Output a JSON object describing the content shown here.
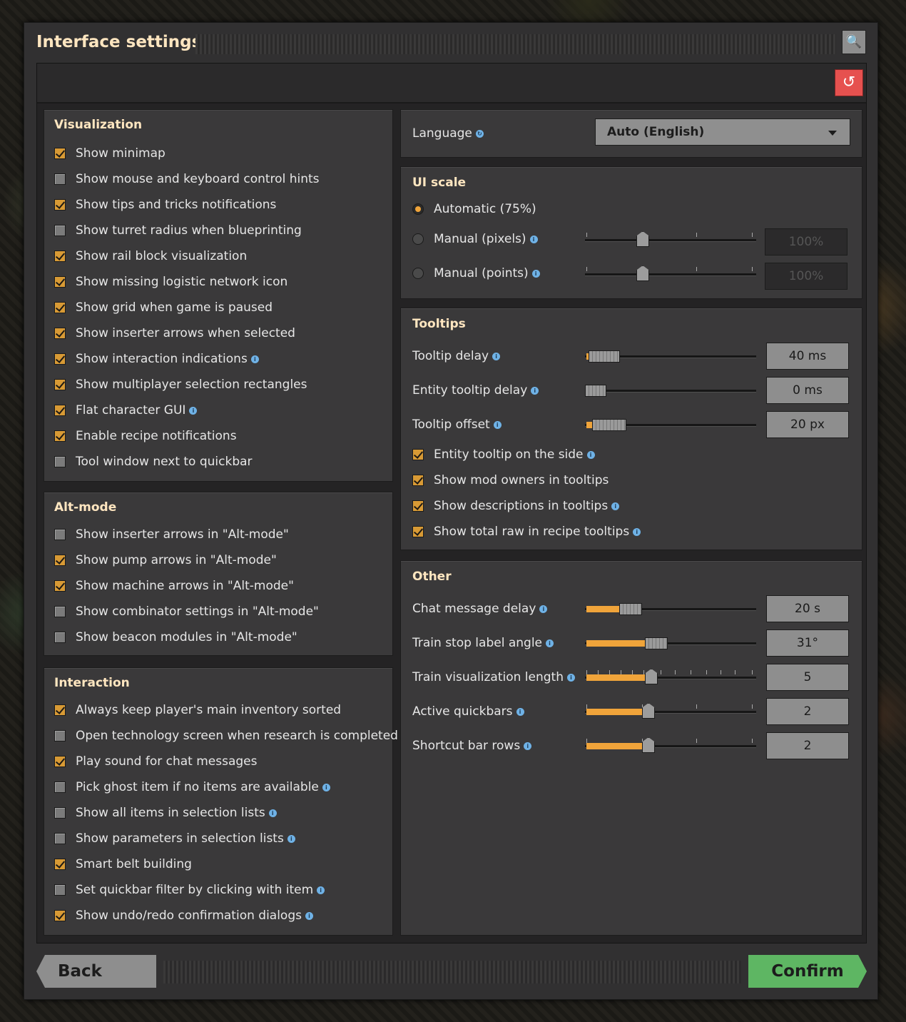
{
  "window": {
    "title": "Interface settings"
  },
  "buttons": {
    "back": "Back",
    "confirm": "Confirm"
  },
  "visualization": {
    "title": "Visualization",
    "items": [
      {
        "label": "Show minimap",
        "checked": true,
        "info": false
      },
      {
        "label": "Show mouse and keyboard control hints",
        "checked": false,
        "info": false
      },
      {
        "label": "Show tips and tricks notifications",
        "checked": true,
        "info": false
      },
      {
        "label": "Show turret radius when blueprinting",
        "checked": false,
        "info": false
      },
      {
        "label": "Show rail block visualization",
        "checked": true,
        "info": false
      },
      {
        "label": "Show missing logistic network icon",
        "checked": true,
        "info": false
      },
      {
        "label": "Show grid when game is paused",
        "checked": true,
        "info": false
      },
      {
        "label": "Show inserter arrows when selected",
        "checked": true,
        "info": false
      },
      {
        "label": "Show interaction indications",
        "checked": true,
        "info": true
      },
      {
        "label": "Show multiplayer selection rectangles",
        "checked": true,
        "info": false
      },
      {
        "label": "Flat character GUI",
        "checked": true,
        "info": true
      },
      {
        "label": "Enable recipe notifications",
        "checked": true,
        "info": false
      },
      {
        "label": "Tool window next to quickbar",
        "checked": false,
        "info": false
      }
    ]
  },
  "altmode": {
    "title": "Alt-mode",
    "items": [
      {
        "label": "Show inserter arrows in \"Alt-mode\"",
        "checked": false,
        "info": false
      },
      {
        "label": "Show pump arrows in \"Alt-mode\"",
        "checked": true,
        "info": false
      },
      {
        "label": "Show machine arrows in \"Alt-mode\"",
        "checked": true,
        "info": false
      },
      {
        "label": "Show combinator settings in \"Alt-mode\"",
        "checked": false,
        "info": false
      },
      {
        "label": "Show beacon modules in \"Alt-mode\"",
        "checked": false,
        "info": false
      }
    ]
  },
  "interaction": {
    "title": "Interaction",
    "items": [
      {
        "label": "Always keep player's main inventory sorted",
        "checked": true,
        "info": false
      },
      {
        "label": "Open technology screen when research is completed",
        "checked": false,
        "info": false
      },
      {
        "label": "Play sound for chat messages",
        "checked": true,
        "info": false
      },
      {
        "label": "Pick ghost item if no items are available",
        "checked": false,
        "info": true
      },
      {
        "label": "Show all items in selection lists",
        "checked": false,
        "info": true
      },
      {
        "label": "Show parameters in selection lists",
        "checked": false,
        "info": true
      },
      {
        "label": "Smart belt building",
        "checked": true,
        "info": false
      },
      {
        "label": "Set quickbar filter by clicking with item",
        "checked": false,
        "info": true
      },
      {
        "label": "Show undo/redo confirmation dialogs",
        "checked": true,
        "info": true
      }
    ]
  },
  "language": {
    "label": "Language",
    "value": "Auto (English)"
  },
  "ui_scale": {
    "title": "UI scale",
    "automatic": "Automatic (75%)",
    "manual_pixels": "Manual (pixels)",
    "manual_points": "Manual (points)",
    "pixels_value": "100%",
    "points_value": "100%",
    "selected": "automatic"
  },
  "tooltips": {
    "title": "Tooltips",
    "sliders": [
      {
        "label": "Tooltip delay",
        "value": "40 ms",
        "fraction": 0.02
      },
      {
        "label": "Entity tooltip delay",
        "value": "0 ms",
        "fraction": 0.0
      },
      {
        "label": "Tooltip offset",
        "value": "20 px",
        "fraction": 0.04
      }
    ],
    "items": [
      {
        "label": "Entity tooltip on the side",
        "checked": true,
        "info": true
      },
      {
        "label": "Show mod owners in tooltips",
        "checked": true,
        "info": false
      },
      {
        "label": "Show descriptions in tooltips",
        "checked": true,
        "info": true
      },
      {
        "label": "Show total raw in recipe tooltips",
        "checked": true,
        "info": true
      }
    ]
  },
  "other": {
    "title": "Other",
    "sliders": [
      {
        "label": "Chat message delay",
        "value": "20 s",
        "fraction": 0.2
      },
      {
        "label": "Train stop label angle",
        "value": "31°",
        "fraction": 0.35
      },
      {
        "label": "Train visualization length",
        "value": "5",
        "fraction": 0.36
      },
      {
        "label": "Active quickbars",
        "value": "2",
        "fraction": 0.34
      },
      {
        "label": "Shortcut bar rows",
        "value": "2",
        "fraction": 0.34
      }
    ]
  },
  "colors": {
    "accent": "#f0a43a",
    "confirm": "#5eb663",
    "reset": "#e6514f",
    "heading": "#ffe6c0"
  }
}
